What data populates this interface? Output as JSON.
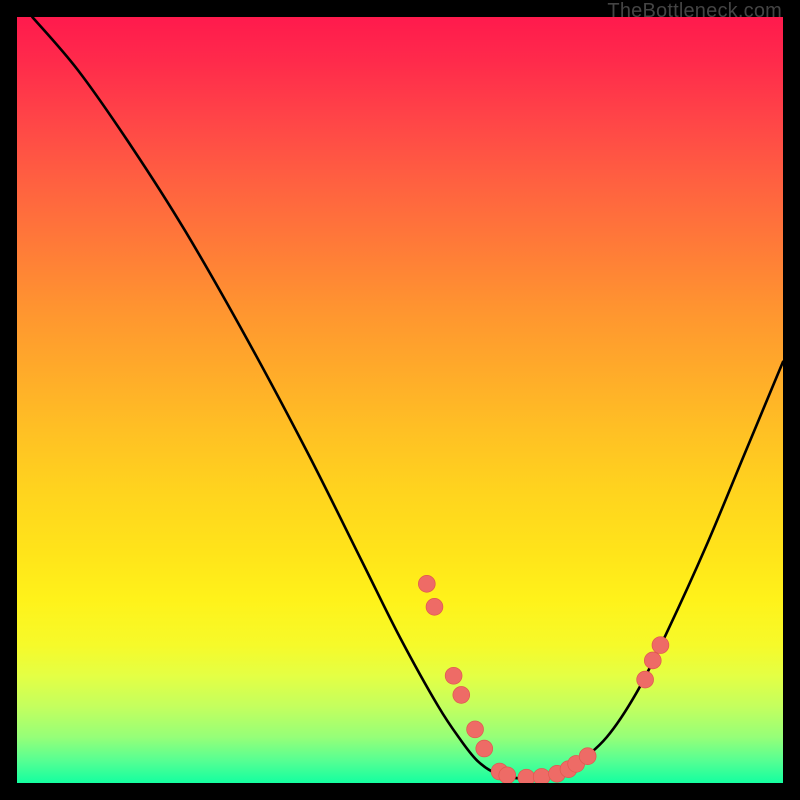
{
  "attribution": "TheBottleneck.com",
  "colors": {
    "page_bg": "#000000",
    "curve_stroke": "#000000",
    "marker_fill": "#ee6b66",
    "marker_stroke": "#e0574f"
  },
  "chart_data": {
    "type": "line",
    "title": "",
    "xlabel": "",
    "ylabel": "",
    "xlim": [
      0,
      100
    ],
    "ylim": [
      0,
      100
    ],
    "series": [
      {
        "name": "curve",
        "x": [
          2,
          8,
          15,
          22,
          30,
          38,
          45,
          50,
          55,
          58,
          60,
          62,
          64,
          67,
          70,
          73,
          77,
          81,
          85,
          90,
          95,
          100
        ],
        "y": [
          100,
          93,
          83,
          72,
          58,
          43,
          29,
          19,
          10,
          5.5,
          3,
          1.5,
          0.8,
          0.6,
          1,
          2.5,
          6,
          12,
          20,
          31,
          43,
          55
        ]
      }
    ],
    "markers": [
      {
        "x": 53.5,
        "y": 26.0
      },
      {
        "x": 54.5,
        "y": 23.0
      },
      {
        "x": 57.0,
        "y": 14.0
      },
      {
        "x": 58.0,
        "y": 11.5
      },
      {
        "x": 59.8,
        "y": 7.0
      },
      {
        "x": 61.0,
        "y": 4.5
      },
      {
        "x": 63.0,
        "y": 1.5
      },
      {
        "x": 64.0,
        "y": 1.0
      },
      {
        "x": 66.5,
        "y": 0.7
      },
      {
        "x": 68.5,
        "y": 0.8
      },
      {
        "x": 70.5,
        "y": 1.2
      },
      {
        "x": 72.0,
        "y": 1.8
      },
      {
        "x": 73.0,
        "y": 2.5
      },
      {
        "x": 74.5,
        "y": 3.5
      },
      {
        "x": 82.0,
        "y": 13.5
      },
      {
        "x": 83.0,
        "y": 16.0
      },
      {
        "x": 84.0,
        "y": 18.0
      }
    ],
    "marker_radius_pct": 1.1
  }
}
